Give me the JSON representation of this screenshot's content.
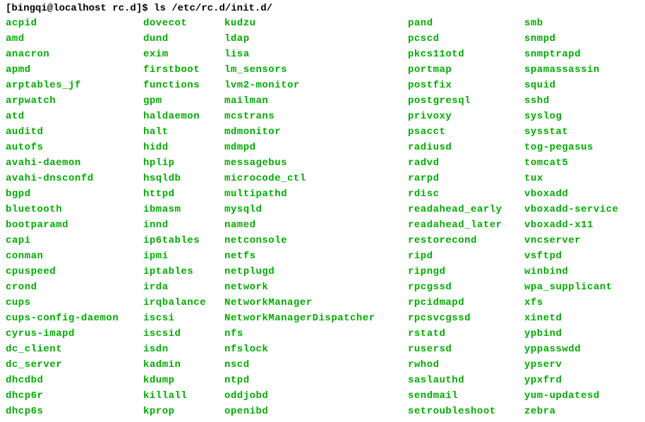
{
  "prompt": {
    "userhost": "[bingqi@localhost rc.d]$ ",
    "command": "ls /etc/rc.d/init.d/"
  },
  "columns": [
    [
      "acpid",
      "amd",
      "anacron",
      "apmd",
      "arptables_jf",
      "arpwatch",
      "atd",
      "auditd",
      "autofs",
      "avahi-daemon",
      "avahi-dnsconfd",
      "bgpd",
      "bluetooth",
      "bootparamd",
      "capi",
      "conman",
      "cpuspeed",
      "crond",
      "cups",
      "cups-config-daemon",
      "cyrus-imapd",
      "dc_client",
      "dc_server",
      "dhcdbd",
      "dhcp6r",
      "dhcp6s"
    ],
    [
      "dovecot",
      "dund",
      "exim",
      "firstboot",
      "functions",
      "gpm",
      "haldaemon",
      "halt",
      "hidd",
      "hplip",
      "hsqldb",
      "httpd",
      "ibmasm",
      "innd",
      "ip6tables",
      "ipmi",
      "iptables",
      "irda",
      "irqbalance",
      "iscsi",
      "iscsid",
      "isdn",
      "kadmin",
      "kdump",
      "killall",
      "kprop"
    ],
    [
      "kudzu",
      "ldap",
      "lisa",
      "lm_sensors",
      "lvm2-monitor",
      "mailman",
      "mcstrans",
      "mdmonitor",
      "mdmpd",
      "messagebus",
      "microcode_ctl",
      "multipathd",
      "mysqld",
      "named",
      "netconsole",
      "netfs",
      "netplugd",
      "network",
      "NetworkManager",
      "NetworkManagerDispatcher",
      "nfs",
      "nfslock",
      "nscd",
      "ntpd",
      "oddjobd",
      "openibd"
    ],
    [
      "pand",
      "pcscd",
      "pkcs11otd",
      "portmap",
      "postfix",
      "postgresql",
      "privoxy",
      "psacct",
      "radiusd",
      "radvd",
      "rarpd",
      "rdisc",
      "readahead_early",
      "readahead_later",
      "restorecond",
      "ripd",
      "ripngd",
      "rpcgssd",
      "rpcidmapd",
      "rpcsvcgssd",
      "rstatd",
      "rusersd",
      "rwhod",
      "saslauthd",
      "sendmail",
      "setroubleshoot"
    ],
    [
      "smb",
      "snmpd",
      "snmptrapd",
      "spamassassin",
      "squid",
      "sshd",
      "syslog",
      "sysstat",
      "tog-pegasus",
      "tomcat5",
      "tux",
      "vboxadd",
      "vboxadd-service",
      "vboxadd-x11",
      "vncserver",
      "vsftpd",
      "winbind",
      "wpa_supplicant",
      "xfs",
      "xinetd",
      "ypbind",
      "yppasswdd",
      "ypserv",
      "ypxfrd",
      "yum-updatesd",
      "zebra"
    ]
  ]
}
